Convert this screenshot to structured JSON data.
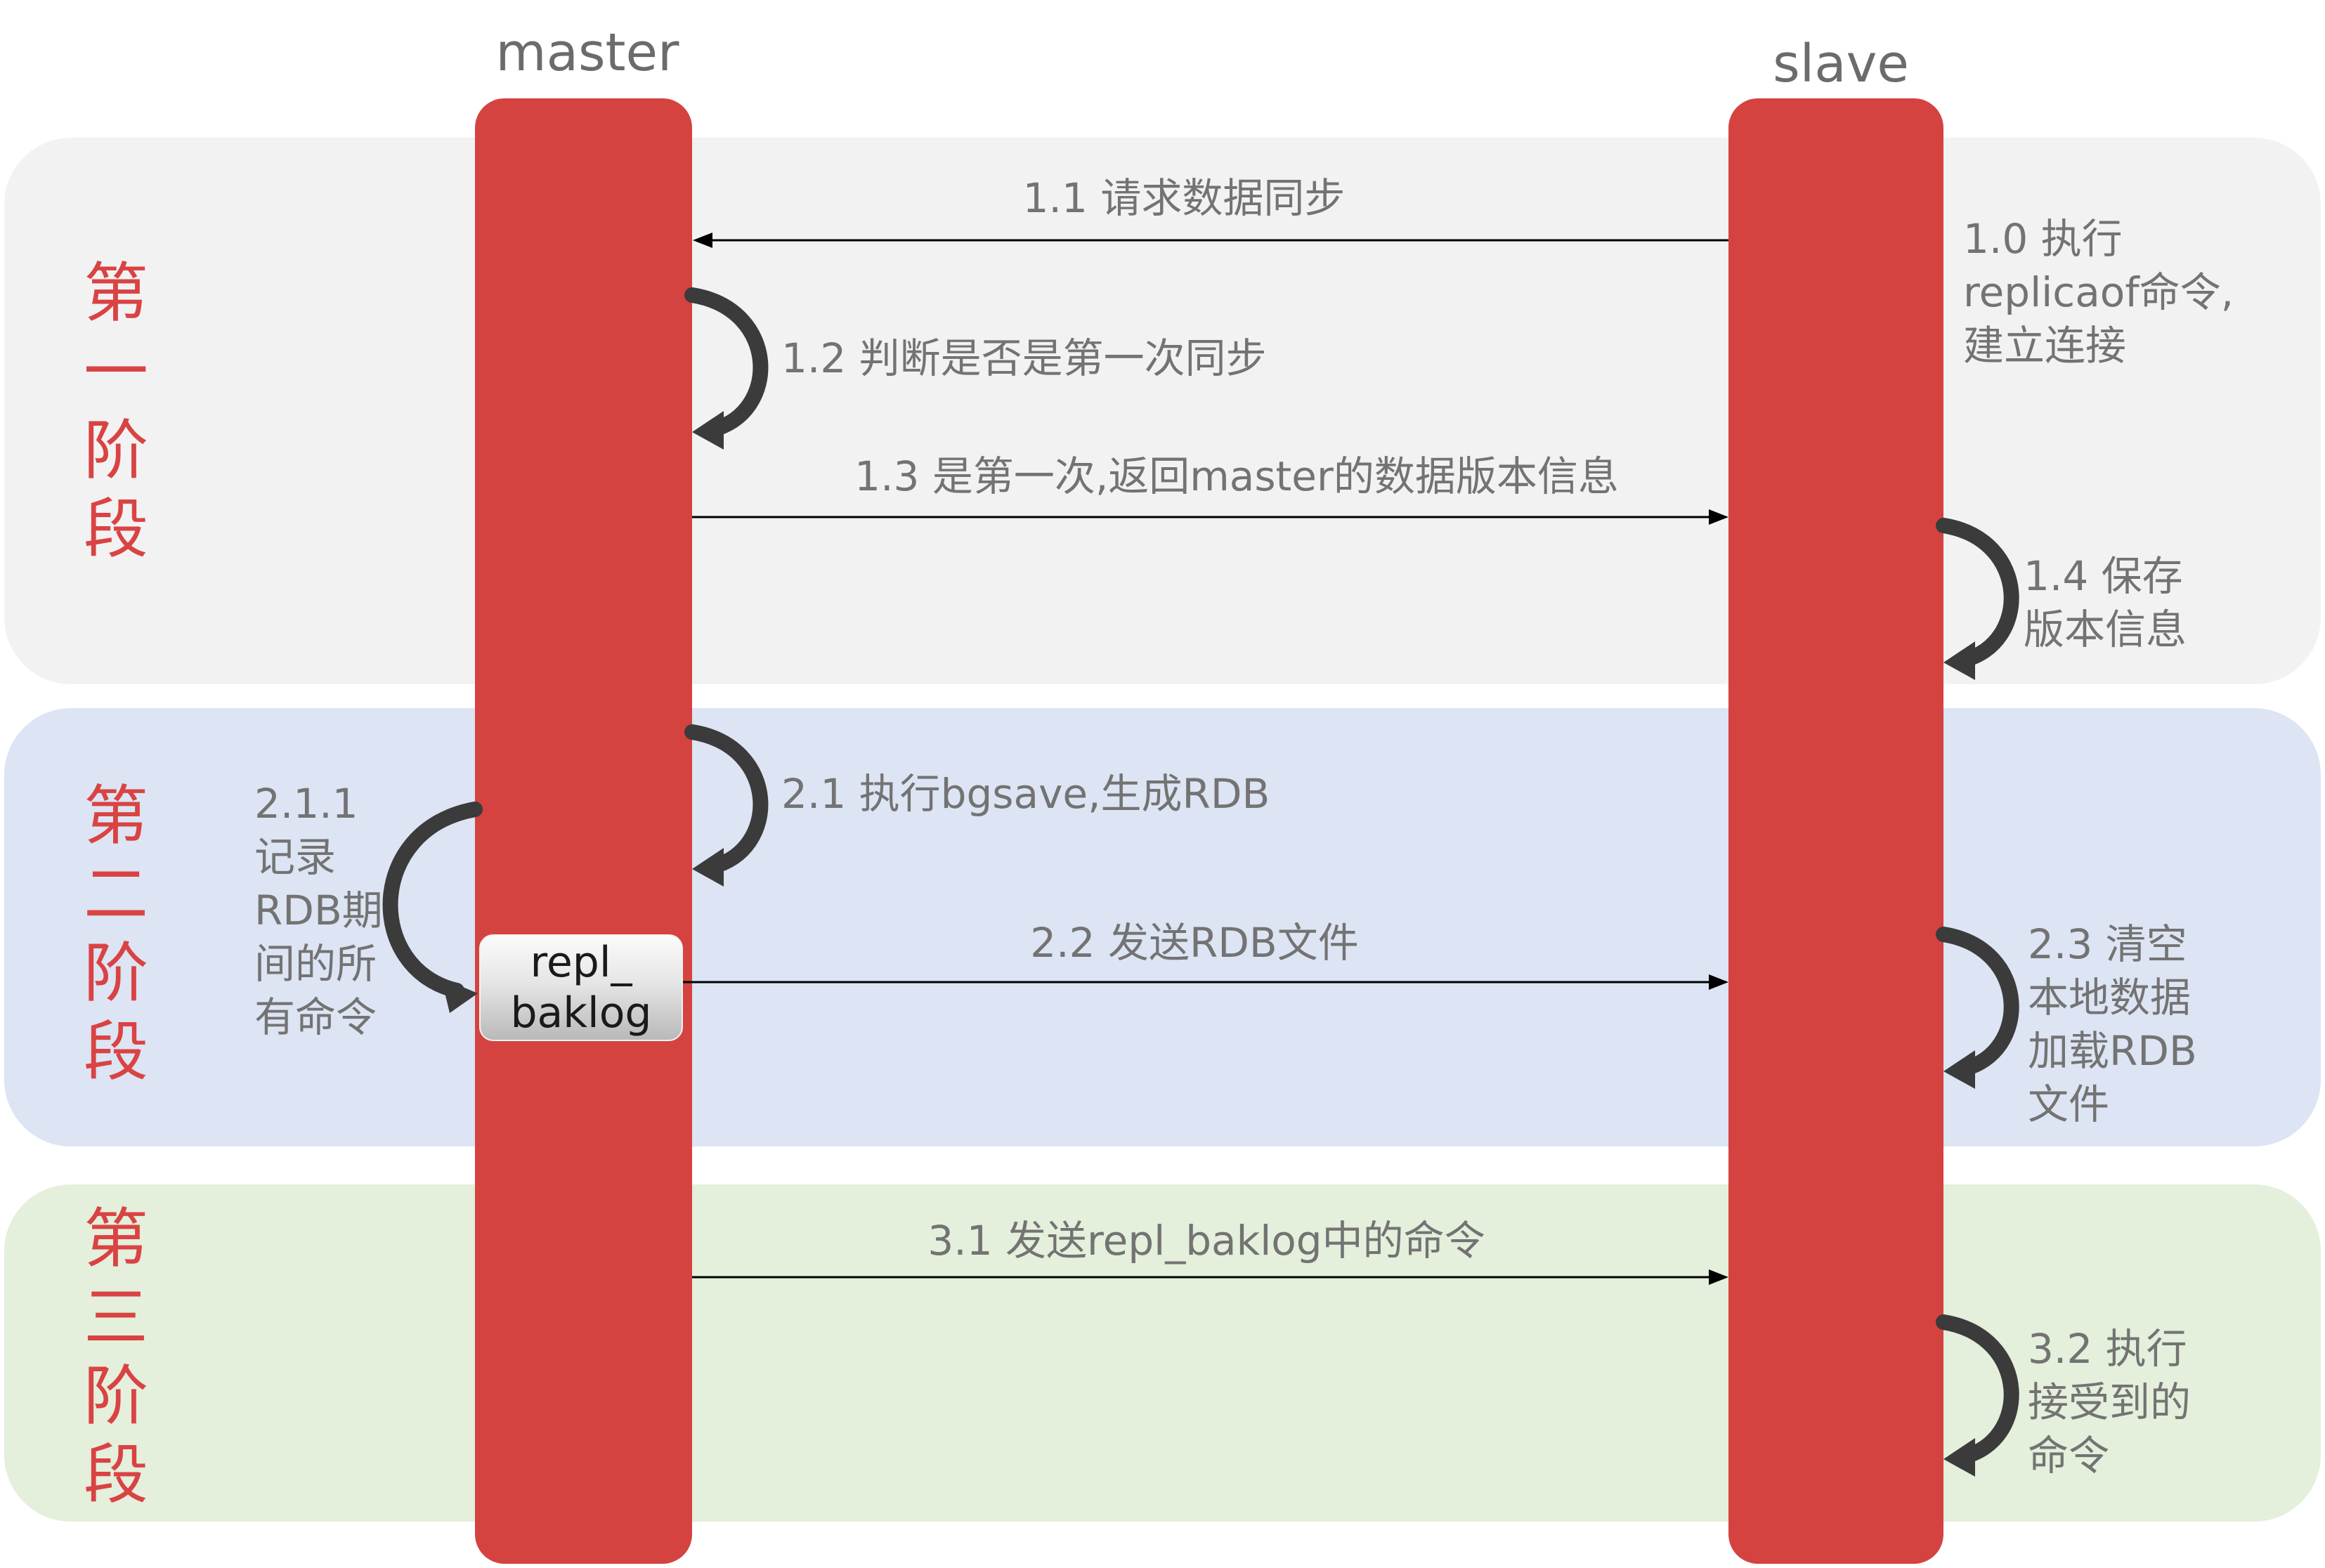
{
  "actors": {
    "master": "master",
    "slave": "slave"
  },
  "phases": [
    {
      "label": "第一阶段"
    },
    {
      "label": "第二阶段"
    },
    {
      "label": "第三阶段"
    }
  ],
  "steps": {
    "s1_0": "1.0 执行\nreplicaof命令,\n建立连接",
    "s1_1": "1.1 请求数据同步",
    "s1_2": "1.2 判断是否是第一次同步",
    "s1_3": "1.3 是第一次,返回master的数据版本信息",
    "s1_4": "1.4 保存\n版本信息",
    "s2_1": "2.1 执行bgsave,生成RDB",
    "s2_1_1": "2.1.1\n记录\nRDB期\n间的所\n有命令",
    "s2_2": "2.2 发送RDB文件",
    "s2_3": "2.3 清空\n本地数据\n加载RDB\n文件",
    "s3_1": "3.1 发送repl_baklog中的命令",
    "s3_2": "3.2 执行\n接受到的\n命令"
  },
  "buffer": "repl_\nbaklog",
  "colors": {
    "lifeline": "#d44340",
    "phase_text": "#d94343",
    "phase1_band": "#f2f2f2",
    "phase2_band": "#dde4f3",
    "phase3_band": "#e4efdc",
    "label_text": "#737373",
    "arrow": "#000000",
    "loop_arrow": "#3b3b3b"
  }
}
